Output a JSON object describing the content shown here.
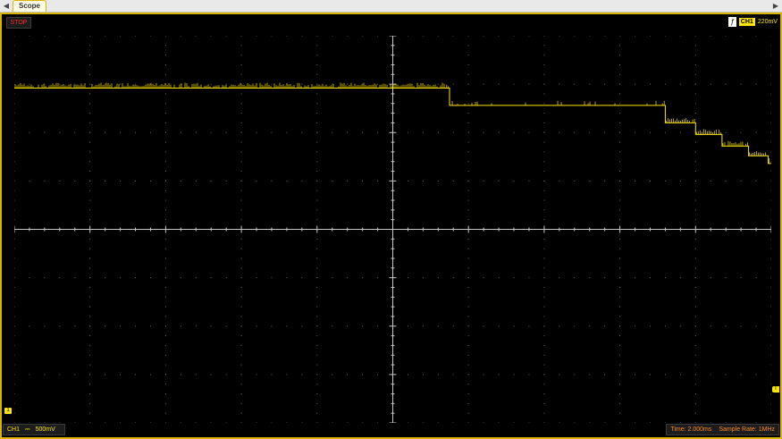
{
  "tabbar": {
    "left_arrow": "◀",
    "right_arrow": "▶",
    "tab_label": "Scope"
  },
  "topbar": {
    "status": "STOP",
    "trigger_icon": "ƒ",
    "trigger_channel": "CH1",
    "trigger_level": "220mV"
  },
  "markers": {
    "channel_marker": "1",
    "trigger_marker": "T"
  },
  "statusbar": {
    "channel": "CH1",
    "coupling": "⎓",
    "volts_per_div": "500mV",
    "time_per_div": "Time: 2.000ms",
    "sample_rate": "Sample Rate: 1MHz"
  },
  "colors": {
    "trace": "#ffe600",
    "frame_border": "#d6b300",
    "grid": "#6a6a6a",
    "stop": "#ff2a2a",
    "status_text": "#ff8a1c"
  },
  "chart_data": {
    "type": "line",
    "x_divisions": 10,
    "y_divisions": 8,
    "xlim": [
      -10,
      10
    ],
    "ylim": [
      -2,
      2
    ],
    "x_unit": "ms",
    "y_unit": "V",
    "grid": true,
    "series": [
      {
        "values": [
          [
            -10,
            1.46
          ],
          [
            1.4,
            1.46
          ],
          [
            1.5,
            1.28
          ],
          [
            7.1,
            1.28
          ],
          [
            7.2,
            1.1
          ],
          [
            7.9,
            1.1
          ],
          [
            8.0,
            0.98
          ],
          [
            8.6,
            0.98
          ],
          [
            8.7,
            0.86
          ],
          [
            9.3,
            0.86
          ],
          [
            9.4,
            0.76
          ],
          [
            9.9,
            0.76
          ],
          [
            9.92,
            0.68
          ],
          [
            10,
            0.68
          ]
        ]
      }
    ]
  }
}
